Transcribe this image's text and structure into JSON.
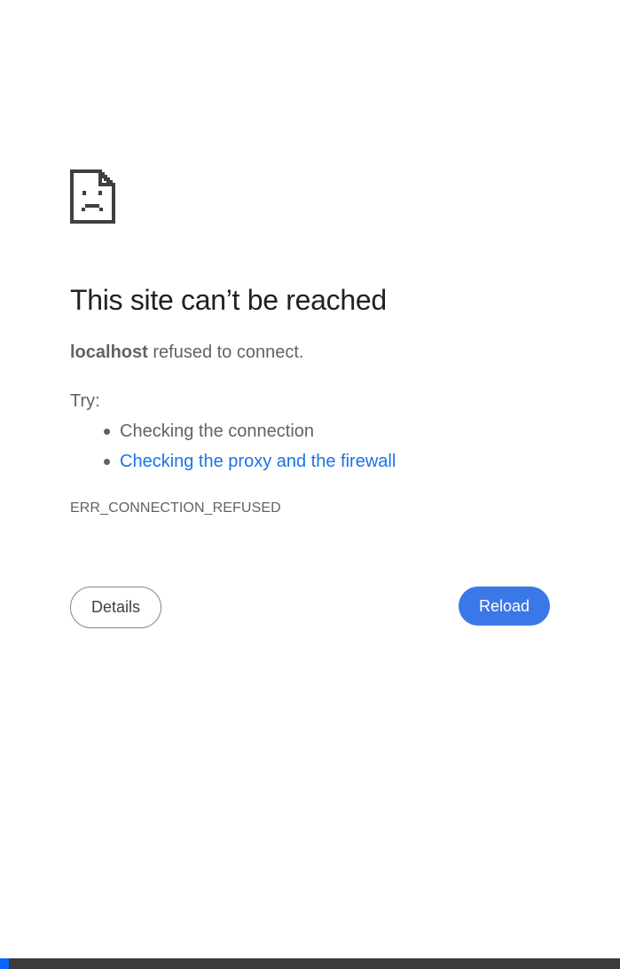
{
  "error": {
    "icon": "sad-page-icon",
    "headline": "This site can’t be reached",
    "host": "localhost",
    "summary_rest": " refused to connect.",
    "try_label": "Try:",
    "suggestions": [
      "Checking the connection",
      "Checking the proxy and the firewall"
    ],
    "code": "ERR_CONNECTION_REFUSED"
  },
  "buttons": {
    "details_label": "Details",
    "reload_label": "Reload"
  },
  "colors": {
    "text_primary": "#202124",
    "text_secondary": "#5f6368",
    "link": "#1a73e8",
    "reload_bg": "#3b78e7",
    "bottom_bar": "#3c3c3c",
    "bottom_accent": "#0a66ff"
  }
}
